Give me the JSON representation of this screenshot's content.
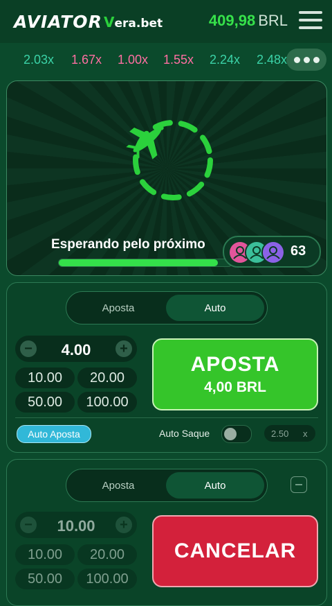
{
  "header": {
    "logo": "AVIATOR",
    "brand_v": "V",
    "brand_rest": "era.bet",
    "balance_amount": "409,98",
    "balance_currency": "BRL"
  },
  "multipliers": [
    {
      "value": "2.03x",
      "color": "#3bd3a8"
    },
    {
      "value": "1.67x",
      "color": "#ff6fa2"
    },
    {
      "value": "1.00x",
      "color": "#ff6fa2"
    },
    {
      "value": "1.55x",
      "color": "#ff6fa2"
    },
    {
      "value": "2.24x",
      "color": "#3bd3a8"
    },
    {
      "value": "2.48x",
      "color": "#3bd3a8"
    }
  ],
  "game": {
    "waiting_text": "Esperando pelo próximo",
    "progress": 0.92,
    "players_count": "63",
    "avatar_colors": [
      "#e2559b",
      "#3bbf9a",
      "#8b62e6"
    ],
    "accent_color": "#2bd13c"
  },
  "panel1": {
    "tab_aposta": "Aposta",
    "tab_auto": "Auto",
    "stake_value": "4.00",
    "minus": "−",
    "plus": "+",
    "chips": [
      "10.00",
      "20.00",
      "50.00",
      "100.00"
    ],
    "button_title": "APOSTA",
    "button_amount": "4,00 BRL",
    "auto_aposta": "Auto Aposta",
    "auto_saque": "Auto Saque",
    "saque_value": "2.50",
    "saque_x": "x"
  },
  "panel2": {
    "tab_aposta": "Aposta",
    "tab_auto": "Auto",
    "stake_value": "10.00",
    "minus": "−",
    "plus": "+",
    "chips": [
      "10.00",
      "20.00",
      "50.00",
      "100.00"
    ],
    "button_title": "CANCELAR"
  }
}
